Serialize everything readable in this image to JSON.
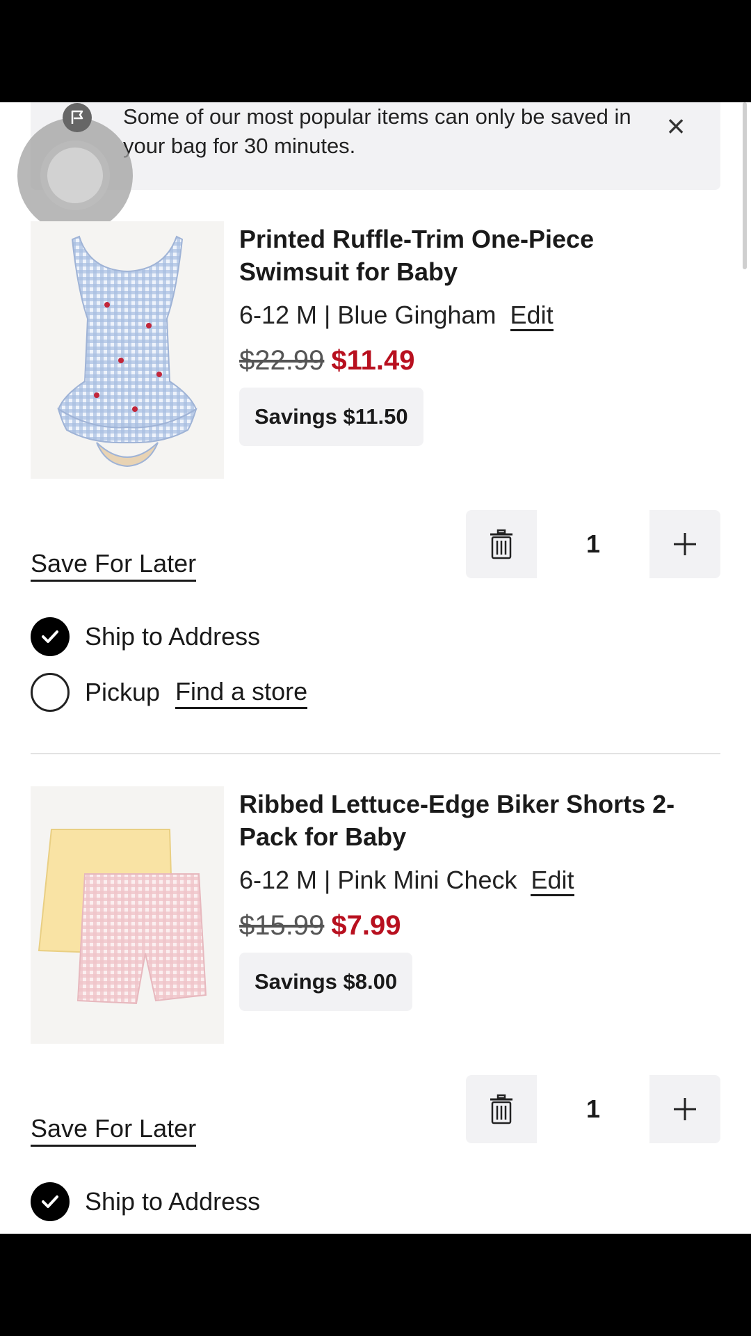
{
  "banner": {
    "message": "Some of our most popular items can only be saved in your bag for 30 minutes.",
    "close_icon": "close-icon"
  },
  "items": [
    {
      "title": "Printed Ruffle-Trim One-Piece Swimsuit for Baby",
      "variant": "6-12 M | Blue Gingham",
      "edit_label": "Edit",
      "price_original": "$22.99",
      "price_sale": "$11.49",
      "savings": "Savings $11.50",
      "save_for_later": "Save For Later",
      "quantity": "1",
      "ship_label": "Ship to Address",
      "pickup_label": "Pickup",
      "find_store_label": "Find a store",
      "shipping_selected": "ship"
    },
    {
      "title": "Ribbed Lettuce-Edge Biker Shorts 2-Pack for Baby",
      "variant": "6-12 M | Pink Mini Check",
      "edit_label": "Edit",
      "price_original": "$15.99",
      "price_sale": "$7.99",
      "savings": "Savings $8.00",
      "save_for_later": "Save For Later",
      "quantity": "1",
      "ship_label": "Ship to Address",
      "shipping_selected": "ship"
    }
  ],
  "colors": {
    "sale_price": "#b8101f",
    "panel_bg": "#f2f2f4",
    "text": "#1a1a1a"
  },
  "icons": [
    "close-icon",
    "trash-icon",
    "plus-icon",
    "check-icon",
    "flag-icon"
  ]
}
